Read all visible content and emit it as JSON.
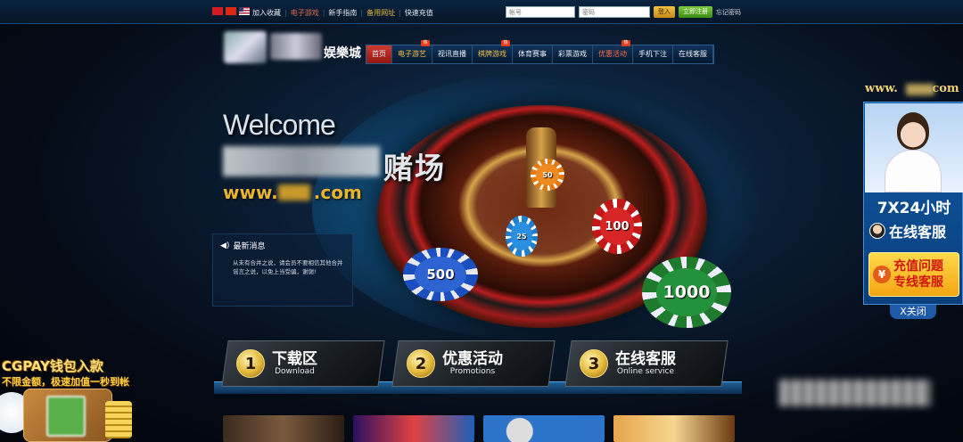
{
  "topbar": {
    "links": [
      "加入收藏",
      "电子游戏",
      "新手指南",
      "备用网址",
      "快速充值"
    ],
    "username_placeholder": "帐号",
    "password_placeholder": "密码",
    "login_label": "登入",
    "register_label": "立即注册",
    "forgot_label": "忘记密码"
  },
  "logo": {
    "text": "娱樂城"
  },
  "nav": {
    "items": [
      {
        "label": "首页",
        "state": "active",
        "hot": false
      },
      {
        "label": "电子游艺",
        "state": "gold",
        "hot": true
      },
      {
        "label": "视讯直播",
        "state": "normal",
        "hot": false
      },
      {
        "label": "棋牌游戏",
        "state": "gold",
        "hot": true
      },
      {
        "label": "体育赛事",
        "state": "normal",
        "hot": false
      },
      {
        "label": "彩票游戏",
        "state": "normal",
        "hot": false
      },
      {
        "label": "优惠活动",
        "state": "red",
        "hot": true
      },
      {
        "label": "手机下注",
        "state": "normal",
        "hot": false
      },
      {
        "label": "在线客服",
        "state": "normal",
        "hot": false
      }
    ],
    "hot_label": "热"
  },
  "hero": {
    "welcome": "Welcome",
    "title_cn": "赌场",
    "url_prefix": "www.",
    "url_suffix": ".com",
    "chips": [
      "500",
      "1000",
      "100",
      "50",
      "25"
    ]
  },
  "news": {
    "title": "最新消息",
    "body": "从未有合并之说，请会员不要相信其他合并谣言之说，以免上当受骗，谢谢!"
  },
  "features": [
    {
      "number": "1",
      "cn": "下载区",
      "en": "Download"
    },
    {
      "number": "2",
      "cn": "优惠活动",
      "en": "Promotions"
    },
    {
      "number": "3",
      "cn": "在线客服",
      "en": "Online service"
    }
  ],
  "right_ad": {
    "url_prefix": "www.",
    "url_suffix": ".com",
    "hours": "7X24小时",
    "service": "在线客服",
    "recharge_line1": "充值问题",
    "recharge_line2": "专线客服",
    "yen": "¥",
    "close": "X关闭"
  },
  "left_ad": {
    "title": "CGPAY钱包入款",
    "subtitle": "不限金额，极速加值一秒到帐"
  },
  "colors": {
    "accent_gold": "#e8b430",
    "nav_active": "#d03a2f",
    "login_button": "#f2c33f",
    "register_button": "#5aaa22"
  }
}
